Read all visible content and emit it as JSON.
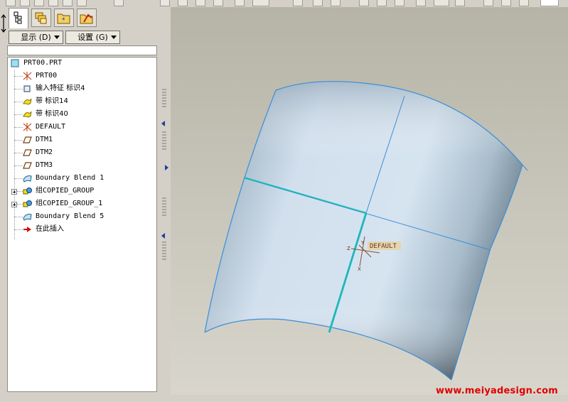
{
  "left_panel": {
    "dropdowns": [
      {
        "label": "显示 (D)"
      },
      {
        "label": "设置 (G)"
      }
    ],
    "tree": {
      "root": "PRT00.PRT",
      "items": [
        {
          "label": "PRT00",
          "icon": "csys-icon"
        },
        {
          "label": "输入特征 标识4",
          "icon": "import-feature-icon"
        },
        {
          "label": "带 标识14",
          "icon": "ribbon-icon"
        },
        {
          "label": "带 标识40",
          "icon": "ribbon-icon"
        },
        {
          "label": "DEFAULT",
          "icon": "csys-icon"
        },
        {
          "label": "DTM1",
          "icon": "datum-plane-icon"
        },
        {
          "label": "DTM2",
          "icon": "datum-plane-icon"
        },
        {
          "label": "DTM3",
          "icon": "datum-plane-icon"
        },
        {
          "label": "Boundary Blend 1",
          "icon": "boundary-blend-icon"
        },
        {
          "label": "组COPIED_GROUP",
          "icon": "group-icon",
          "expandable": true
        },
        {
          "label": "组COPIED_GROUP_1",
          "icon": "group-icon",
          "expandable": true
        },
        {
          "label": "Boundary Blend 5",
          "icon": "boundary-blend-icon"
        },
        {
          "label": "在此插入",
          "icon": "insert-here-arrow-icon"
        }
      ]
    }
  },
  "viewport": {
    "csys_label": "DEFAULT"
  },
  "watermark": "www.meiyadesign.com",
  "colors": {
    "surface_edge": "#3a8fd8",
    "highlight_edge": "#20d0b0",
    "watermark": "#e00000",
    "tree_background": "#ffffff"
  }
}
